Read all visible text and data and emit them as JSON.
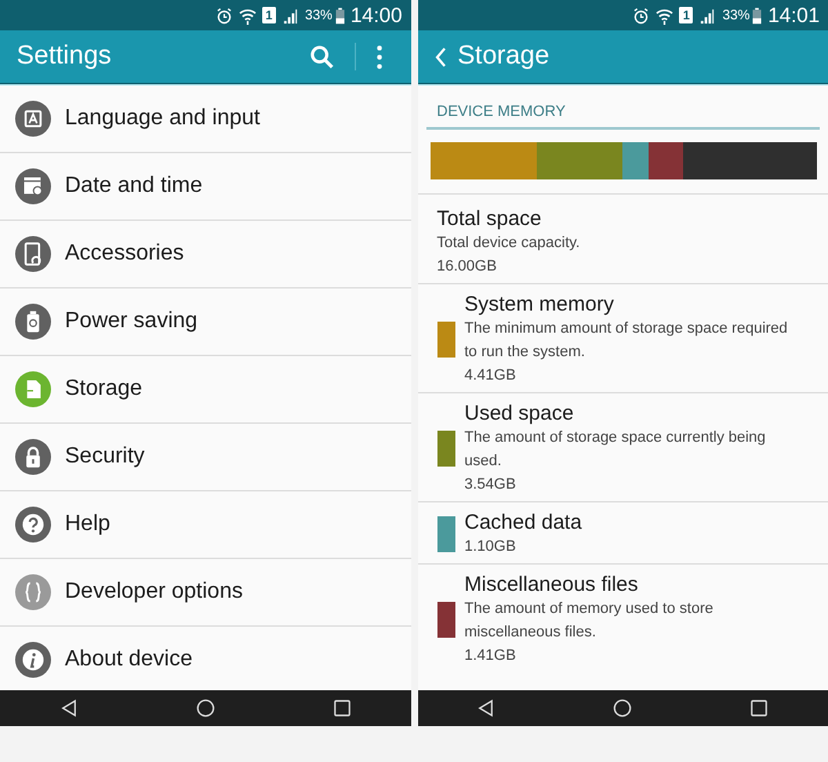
{
  "screens": [
    {
      "status_bar": {
        "sim_slot": "1",
        "battery": "33%",
        "time": "14:00"
      },
      "app_bar": {
        "title": "Settings"
      },
      "items": [
        {
          "label": "Language and input",
          "color": "#616161"
        },
        {
          "label": "Date and time",
          "color": "#616161"
        },
        {
          "label": "Accessories",
          "color": "#616161"
        },
        {
          "label": "Power saving",
          "color": "#616161"
        },
        {
          "label": "Storage",
          "color": "#6cb530"
        },
        {
          "label": "Security",
          "color": "#616161"
        },
        {
          "label": "Help",
          "color": "#616161"
        },
        {
          "label": "Developer options",
          "color": "#9a9a9a"
        },
        {
          "label": "About device",
          "color": "#616161"
        }
      ]
    },
    {
      "status_bar": {
        "sim_slot": "1",
        "battery": "33%",
        "time": "14:01"
      },
      "app_bar": {
        "title": "Storage"
      },
      "section": "DEVICE MEMORY",
      "total": {
        "title": "Total space",
        "description": "Total device capacity.",
        "size": "16.00GB"
      },
      "categories": [
        {
          "title": "System memory",
          "description": "The minimum amount of storage space required to run the system.",
          "size": "4.41GB",
          "color": "#bb8a14"
        },
        {
          "title": "Used space",
          "description": "The amount of storage space currently being used.",
          "size": "3.54GB",
          "color": "#7a861f"
        },
        {
          "title": "Cached data",
          "size": "1.10GB",
          "color": "#4b9a9c"
        },
        {
          "title": "Miscellaneous files",
          "description": "The amount of memory used to store miscellaneous files.",
          "size": "1.41GB",
          "color": "#853236"
        }
      ]
    }
  ]
}
